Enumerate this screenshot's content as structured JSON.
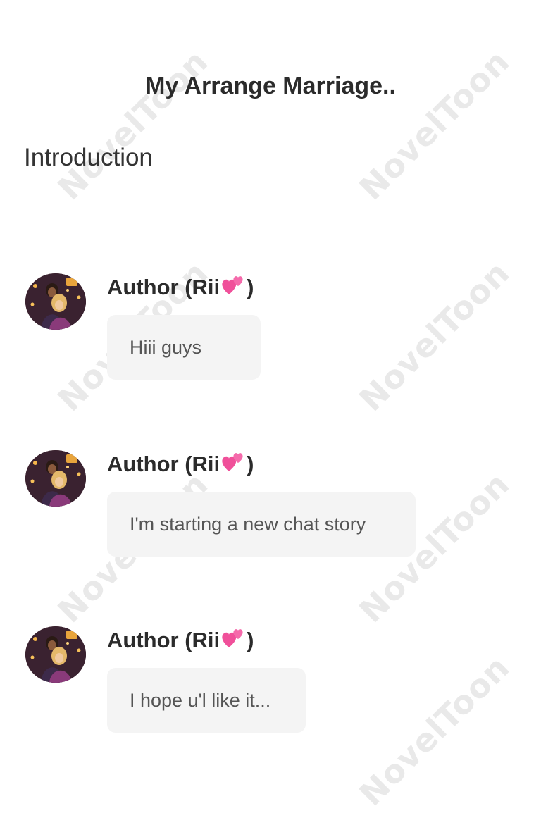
{
  "header": {
    "title": "My Arrange Marriage.."
  },
  "section": {
    "heading": "Introduction"
  },
  "watermark": {
    "text": "NovelToon",
    "color": "#e9e9e9"
  },
  "messages": [
    {
      "author": "Author (Rii",
      "author_suffix": ")",
      "author_emoji": "two-hearts-icon",
      "text": "Hiii guys"
    },
    {
      "author": "Author (Rii",
      "author_suffix": ")",
      "author_emoji": "two-hearts-icon",
      "text": "I'm starting a new chat story"
    },
    {
      "author": "Author (Rii",
      "author_suffix": ")",
      "author_emoji": "two-hearts-icon",
      "text": "I hope u'l like it..."
    }
  ],
  "colors": {
    "text_primary": "#2b2b2b",
    "bubble_background": "#f4f4f4",
    "bubble_text": "#555555",
    "heart": "#f0509a"
  }
}
